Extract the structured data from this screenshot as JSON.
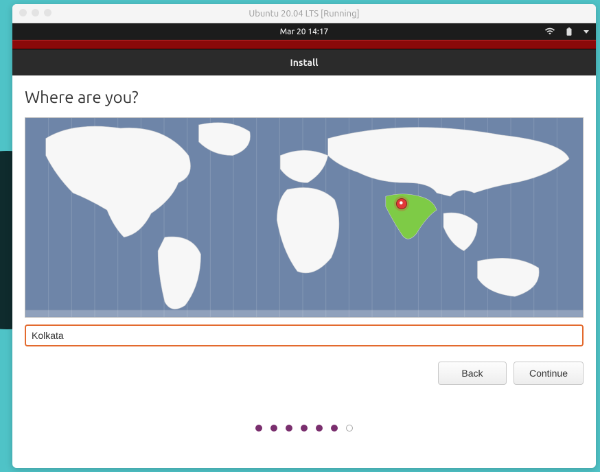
{
  "vm": {
    "title": "Ubuntu 20.04 LTS [Running]"
  },
  "topbar": {
    "datetime": "Mar 20  14:17"
  },
  "installer": {
    "header": "Install",
    "heading": "Where are you?",
    "location_value": "Kolkata",
    "back_label": "Back",
    "continue_label": "Continue"
  },
  "progress": {
    "total": 7,
    "completed": 6
  },
  "icons": {
    "network": "network-icon",
    "battery": "battery-icon",
    "chevron": "chevron-down-icon"
  },
  "colors": {
    "accent_orange": "#e36a2e",
    "accent_red": "#8a0909",
    "selected_green": "#7ecb46",
    "progress_purple": "#7a2f6e"
  }
}
